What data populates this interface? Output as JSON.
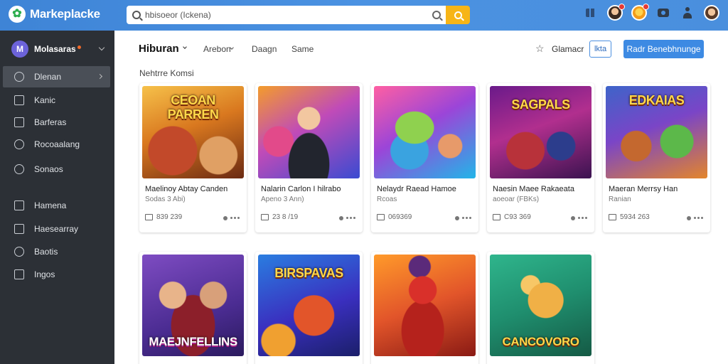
{
  "app": {
    "name": "Markeplacke"
  },
  "search": {
    "value": "hbisoeor (Ickena)"
  },
  "sidebar": {
    "profile_name": "Molasaras",
    "items": [
      {
        "label": "Dlenan",
        "active": true
      },
      {
        "label": "Kanic"
      },
      {
        "label": "Barferas"
      },
      {
        "label": "Rocoaalang"
      },
      {
        "label": "Sonaos"
      },
      {
        "label": "Hamena"
      },
      {
        "label": "Haesearray"
      },
      {
        "label": "Baotis"
      },
      {
        "label": "Ingos"
      }
    ]
  },
  "header": {
    "title": "Hiburan",
    "tabs": [
      "Arebon",
      "Daagn",
      "Same"
    ],
    "star_label": "Glamacr",
    "small_button": "lkta",
    "primary_button": "Radr Benebhnunge"
  },
  "section_label": "Nehtrre Komsi",
  "cards": [
    {
      "thumb_text": "CEOAN\nPARREN",
      "title": "Maelinoy Abtay Canden",
      "sub": "Sodas 3 Abi)",
      "meta": "839 239"
    },
    {
      "thumb_text": "",
      "title": "Nalarin Carlon I hilrabo",
      "sub": "Apeno 3 Ann)",
      "meta": "23 8 /19"
    },
    {
      "thumb_text": "",
      "title": "Nelaydr Raead Hamoe",
      "sub": "Rcoas",
      "meta": "069369"
    },
    {
      "thumb_text": "SAGPALS",
      "title": "Naesin Maee Rakaeata",
      "sub": "aoeoar (FBKs)",
      "meta": "C93 369"
    },
    {
      "thumb_text": "EDKAIAS",
      "title": "Maeran Merrsy Han",
      "sub": "Ranian",
      "meta": "5934 263"
    },
    {
      "thumb_text": "MAEJNFELLINS",
      "title": "",
      "sub": "",
      "meta": ""
    },
    {
      "thumb_text": "BIRSPAVAS",
      "title": "",
      "sub": "",
      "meta": ""
    },
    {
      "thumb_text": "",
      "title": "",
      "sub": "",
      "meta": ""
    },
    {
      "thumb_text": "CANCOVORO",
      "title": "",
      "sub": "",
      "meta": ""
    }
  ],
  "colors": {
    "topbar": "#4b92e2",
    "sidebar": "#2c3036",
    "primary": "#3d8ae3",
    "search_button": "#f7b517"
  }
}
